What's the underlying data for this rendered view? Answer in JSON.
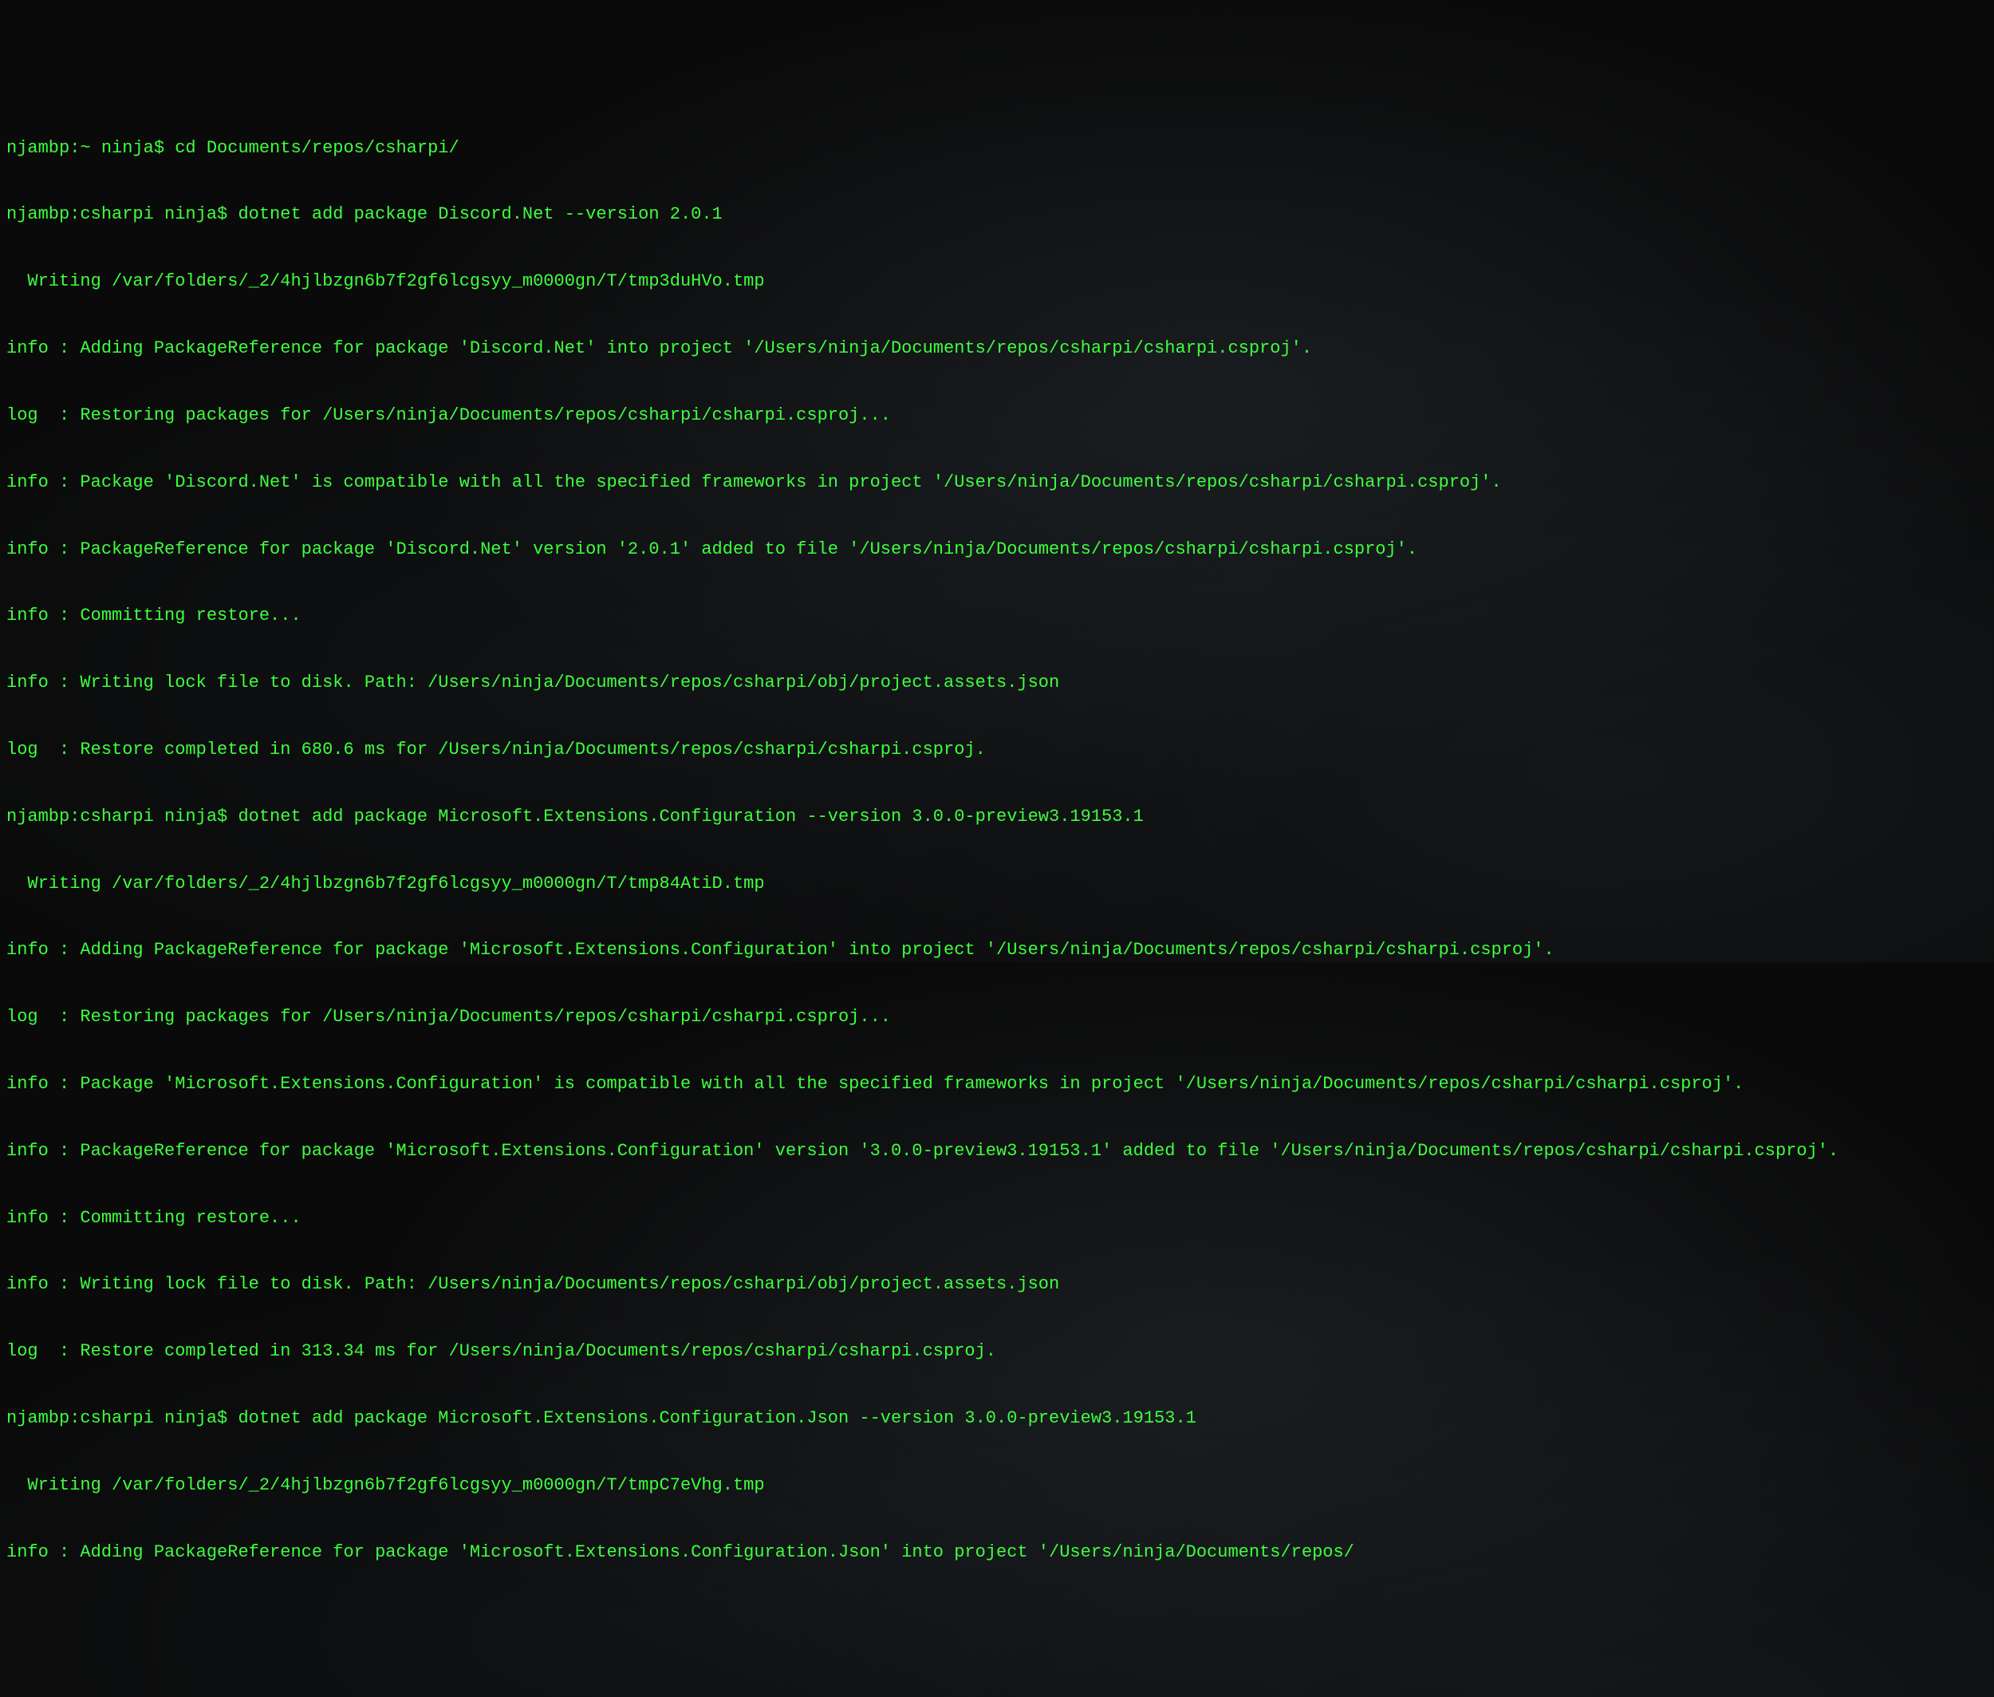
{
  "terminal": {
    "lines": [
      "njambp:~ ninja$ cd Documents/repos/csharpi/",
      "njambp:csharpi ninja$ dotnet add package Discord.Net --version 2.0.1",
      "  Writing /var/folders/_2/4hjlbzgn6b7f2gf6lcgsyy_m0000gn/T/tmp3duHVo.tmp",
      "info : Adding PackageReference for package 'Discord.Net' into project '/Users/ninja/Documents/repos/csharpi/csharpi.csproj'.",
      "log  : Restoring packages for /Users/ninja/Documents/repos/csharpi/csharpi.csproj...",
      "info : Package 'Discord.Net' is compatible with all the specified frameworks in project '/Users/ninja/Documents/repos/csharpi/csharpi.csproj'.",
      "info : PackageReference for package 'Discord.Net' version '2.0.1' added to file '/Users/ninja/Documents/repos/csharpi/csharpi.csproj'.",
      "info : Committing restore...",
      "info : Writing lock file to disk. Path: /Users/ninja/Documents/repos/csharpi/obj/project.assets.json",
      "log  : Restore completed in 680.6 ms for /Users/ninja/Documents/repos/csharpi/csharpi.csproj.",
      "njambp:csharpi ninja$ dotnet add package Microsoft.Extensions.Configuration --version 3.0.0-preview3.19153.1",
      "  Writing /var/folders/_2/4hjlbzgn6b7f2gf6lcgsyy_m0000gn/T/tmp84AtiD.tmp",
      "info : Adding PackageReference for package 'Microsoft.Extensions.Configuration' into project '/Users/ninja/Documents/repos/csharpi/csharpi.csproj'.",
      "log  : Restoring packages for /Users/ninja/Documents/repos/csharpi/csharpi.csproj...",
      "info : Package 'Microsoft.Extensions.Configuration' is compatible with all the specified frameworks in project '/Users/ninja/Documents/repos/csharpi/csharpi.csproj'.",
      "info : PackageReference for package 'Microsoft.Extensions.Configuration' version '3.0.0-preview3.19153.1' added to file '/Users/ninja/Documents/repos/csharpi/csharpi.csproj'.",
      "info : Committing restore...",
      "info : Writing lock file to disk. Path: /Users/ninja/Documents/repos/csharpi/obj/project.assets.json",
      "log  : Restore completed in 313.34 ms for /Users/ninja/Documents/repos/csharpi/csharpi.csproj.",
      "njambp:csharpi ninja$ dotnet add package Microsoft.Extensions.Configuration.Json --version 3.0.0-preview3.19153.1",
      "  Writing /var/folders/_2/4hjlbzgn6b7f2gf6lcgsyy_m0000gn/T/tmpC7eVhg.tmp",
      "info : Adding PackageReference for package 'Microsoft.Extensions.Configuration.Json' into project '/Users/ninja/Documents/repos/"
    ]
  }
}
